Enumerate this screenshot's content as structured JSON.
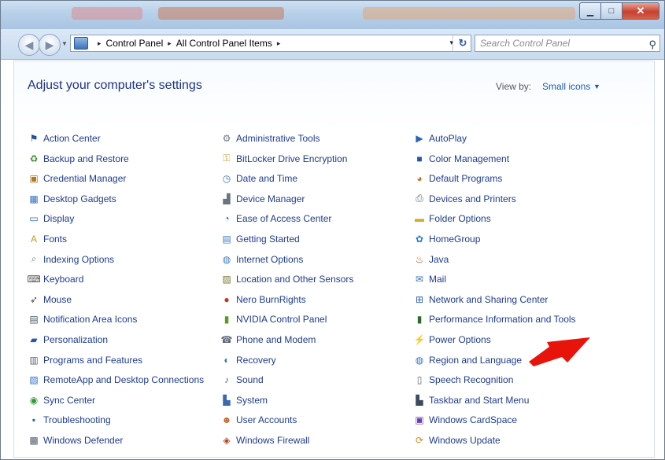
{
  "window": {
    "minimize_glyph": "▁",
    "maximize_glyph": "□",
    "close_glyph": "✕"
  },
  "address": {
    "sep1": "▸",
    "crumb1": "Control Panel",
    "sep2": "▸",
    "crumb2": "All Control Panel Items",
    "sep3": "▸",
    "dropdown_glyph": "▾",
    "refresh_glyph": "↻"
  },
  "search": {
    "placeholder": "Search Control Panel",
    "icon_glyph": "⚲"
  },
  "content": {
    "heading": "Adjust your computer's settings",
    "view_by_label": "View by:",
    "view_by_value": "Small icons",
    "view_by_caret": "▼"
  },
  "columns": [
    [
      {
        "name": "action-center",
        "label": "Action Center",
        "icon": "flag-icon",
        "glyph": "⚑",
        "color": "#1a4fa3"
      },
      {
        "name": "backup-and-restore",
        "label": "Backup and Restore",
        "icon": "backup-icon",
        "glyph": "♻",
        "color": "#3b8a2e"
      },
      {
        "name": "credential-manager",
        "label": "Credential Manager",
        "icon": "credential-icon",
        "glyph": "▣",
        "color": "#b07a1e"
      },
      {
        "name": "desktop-gadgets",
        "label": "Desktop Gadgets",
        "icon": "gadgets-icon",
        "glyph": "▦",
        "color": "#2f6cc4"
      },
      {
        "name": "display",
        "label": "Display",
        "icon": "display-icon",
        "glyph": "▭",
        "color": "#2c62b3"
      },
      {
        "name": "fonts",
        "label": "Fonts",
        "icon": "fonts-icon",
        "glyph": "A",
        "color": "#c7961c"
      },
      {
        "name": "indexing-options",
        "label": "Indexing Options",
        "icon": "indexing-icon",
        "glyph": "⌕",
        "color": "#6a7a8e"
      },
      {
        "name": "keyboard",
        "label": "Keyboard",
        "icon": "keyboard-icon",
        "glyph": "⌨",
        "color": "#555555"
      },
      {
        "name": "mouse",
        "label": "Mouse",
        "icon": "mouse-icon",
        "glyph": "➶",
        "color": "#444444"
      },
      {
        "name": "notification-area-icons",
        "label": "Notification Area Icons",
        "icon": "notification-icon",
        "glyph": "▤",
        "color": "#4a5a70"
      },
      {
        "name": "personalization",
        "label": "Personalization",
        "icon": "personalization-icon",
        "glyph": "▰",
        "color": "#2457b0"
      },
      {
        "name": "programs-and-features",
        "label": "Programs and Features",
        "icon": "programs-icon",
        "glyph": "▥",
        "color": "#5d6a7c"
      },
      {
        "name": "remoteapp-and-desktop-connections",
        "label": "RemoteApp and Desktop Connections",
        "icon": "remoteapp-icon",
        "glyph": "▧",
        "color": "#2d6fc7"
      },
      {
        "name": "sync-center",
        "label": "Sync Center",
        "icon": "sync-icon",
        "glyph": "◉",
        "color": "#2f9a34"
      },
      {
        "name": "troubleshooting",
        "label": "Troubleshooting",
        "icon": "troubleshooting-icon",
        "glyph": "▪",
        "color": "#2b63b3"
      },
      {
        "name": "windows-defender",
        "label": "Windows Defender",
        "icon": "defender-icon",
        "glyph": "▩",
        "color": "#555f6c"
      }
    ],
    [
      {
        "name": "administrative-tools",
        "label": "Administrative Tools",
        "icon": "admin-tools-icon",
        "glyph": "⚙",
        "color": "#6b7785"
      },
      {
        "name": "bitlocker-drive-encryption",
        "label": "BitLocker Drive Encryption",
        "icon": "bitlocker-icon",
        "glyph": "⚿",
        "color": "#c99a2a"
      },
      {
        "name": "date-and-time",
        "label": "Date and Time",
        "icon": "clock-icon",
        "glyph": "◷",
        "color": "#3a6fb8"
      },
      {
        "name": "device-manager",
        "label": "Device Manager",
        "icon": "device-manager-icon",
        "glyph": "▟",
        "color": "#6a7482"
      },
      {
        "name": "ease-of-access-center",
        "label": "Ease of Access Center",
        "icon": "ease-of-access-icon",
        "glyph": "◔",
        "color": "#2a61b4"
      },
      {
        "name": "getting-started",
        "label": "Getting Started",
        "icon": "getting-started-icon",
        "glyph": "▤",
        "color": "#3d78c8"
      },
      {
        "name": "internet-options",
        "label": "Internet Options",
        "icon": "internet-icon",
        "glyph": "◍",
        "color": "#3e7bc4"
      },
      {
        "name": "location-and-other-sensors",
        "label": "Location and Other Sensors",
        "icon": "sensors-icon",
        "glyph": "▨",
        "color": "#7a7a3a"
      },
      {
        "name": "nero-burnrights",
        "label": "Nero BurnRights",
        "icon": "nero-icon",
        "glyph": "●",
        "color": "#c8321e"
      },
      {
        "name": "nvidia-control-panel",
        "label": "NVIDIA Control Panel",
        "icon": "nvidia-icon",
        "glyph": "▮",
        "color": "#5a9a1e"
      },
      {
        "name": "phone-and-modem",
        "label": "Phone and Modem",
        "icon": "phone-icon",
        "glyph": "☎",
        "color": "#5a6577"
      },
      {
        "name": "recovery",
        "label": "Recovery",
        "icon": "recovery-icon",
        "glyph": "◐",
        "color": "#2f74c4"
      },
      {
        "name": "sound",
        "label": "Sound",
        "icon": "speaker-icon",
        "glyph": "♪",
        "color": "#5f6672"
      },
      {
        "name": "system",
        "label": "System",
        "icon": "system-icon",
        "glyph": "▙",
        "color": "#3a68b0"
      },
      {
        "name": "user-accounts",
        "label": "User Accounts",
        "icon": "users-icon",
        "glyph": "☻",
        "color": "#c46a2a"
      },
      {
        "name": "windows-firewall",
        "label": "Windows Firewall",
        "icon": "firewall-icon",
        "glyph": "◈",
        "color": "#b0421e"
      }
    ],
    [
      {
        "name": "autoplay",
        "label": "AutoPlay",
        "icon": "autoplay-icon",
        "glyph": "▶",
        "color": "#2a63b5"
      },
      {
        "name": "color-management",
        "label": "Color Management",
        "icon": "color-icon",
        "glyph": "■",
        "color": "#2456a8"
      },
      {
        "name": "default-programs",
        "label": "Default Programs",
        "icon": "default-programs-icon",
        "glyph": "◕",
        "color": "#d46a1a"
      },
      {
        "name": "devices-and-printers",
        "label": "Devices and Printers",
        "icon": "printer-icon",
        "glyph": "⎙",
        "color": "#5b6676"
      },
      {
        "name": "folder-options",
        "label": "Folder Options",
        "icon": "folder-icon",
        "glyph": "▬",
        "color": "#d9a62a"
      },
      {
        "name": "homegroup",
        "label": "HomeGroup",
        "icon": "homegroup-icon",
        "glyph": "✿",
        "color": "#2f7ad1"
      },
      {
        "name": "java",
        "label": "Java",
        "icon": "java-icon",
        "glyph": "♨",
        "color": "#c6501c"
      },
      {
        "name": "mail",
        "label": "Mail",
        "icon": "mail-icon",
        "glyph": "✉",
        "color": "#3a6fb8"
      },
      {
        "name": "network-and-sharing-center",
        "label": "Network and Sharing Center",
        "icon": "network-icon",
        "glyph": "⊞",
        "color": "#2d62b0"
      },
      {
        "name": "performance-information-and-tools",
        "label": "Performance Information and Tools",
        "icon": "performance-icon",
        "glyph": "▮",
        "color": "#2e6a2a"
      },
      {
        "name": "power-options",
        "label": "Power Options",
        "icon": "power-icon",
        "glyph": "⚡",
        "color": "#3d8a2a"
      },
      {
        "name": "region-and-language",
        "label": "Region and Language",
        "icon": "globe-icon",
        "glyph": "◍",
        "color": "#2c7ac0"
      },
      {
        "name": "speech-recognition",
        "label": "Speech Recognition",
        "icon": "microphone-icon",
        "glyph": "▯",
        "color": "#5a6472"
      },
      {
        "name": "taskbar-and-start-menu",
        "label": "Taskbar and Start Menu",
        "icon": "taskbar-icon",
        "glyph": "▙",
        "color": "#3b4a5e"
      },
      {
        "name": "windows-cardspace",
        "label": "Windows CardSpace",
        "icon": "cardspace-icon",
        "glyph": "▣",
        "color": "#6b3fb0"
      },
      {
        "name": "windows-update",
        "label": "Windows Update",
        "icon": "windows-update-icon",
        "glyph": "⟳",
        "color": "#d78a1e"
      }
    ]
  ],
  "annotation": {
    "arrow_color": "#e8140c"
  }
}
